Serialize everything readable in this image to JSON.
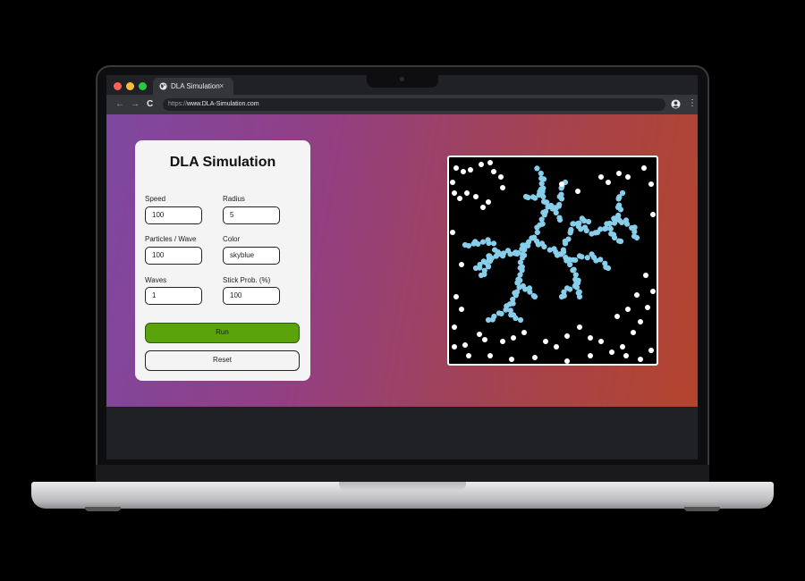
{
  "browser": {
    "tab_title": "DLA Simulation",
    "tab_close": "×",
    "url_scheme": "https://",
    "url_host": "www.DLA-Simulation.com",
    "nav_back": "←",
    "nav_forward": "→",
    "nav_reload": "C",
    "menu_glyph": "⋮",
    "traffic_colors": {
      "close": "#ff5f57",
      "minimize": "#febc2e",
      "maximize": "#28c840"
    }
  },
  "card": {
    "title": "DLA Simulation",
    "fields": {
      "speed": {
        "label": "Speed",
        "value": "100"
      },
      "radius": {
        "label": "Radius",
        "value": "5"
      },
      "particles": {
        "label": "Particles / Wave",
        "value": "100"
      },
      "color": {
        "label": "Color",
        "value": "skyblue"
      },
      "waves": {
        "label": "Waves",
        "value": "1"
      },
      "stick": {
        "label": "Stick Prob. (%)",
        "value": "100"
      }
    },
    "run_label": "Run",
    "reset_label": "Reset"
  },
  "simulation": {
    "particle_color": "skyblue",
    "free_particle_color": "#ffffff",
    "background": "#000000"
  }
}
